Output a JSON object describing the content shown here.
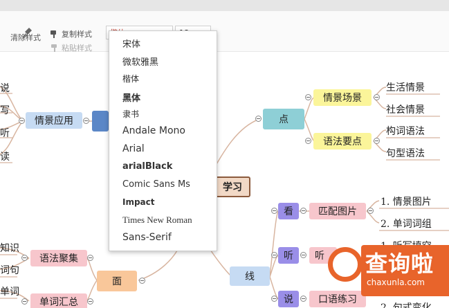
{
  "toolbar": {
    "clear_style": "清除样式",
    "copy_style": "复制样式",
    "paste_style": "粘贴样式",
    "font_value": "楷体",
    "size_value": "18"
  },
  "font_menu": {
    "items": [
      "宋体",
      "微软雅黑",
      "楷体",
      "黑体",
      "隶书",
      "Andale Mono",
      "Arial",
      "arialBlack",
      "Comic Sans Ms",
      "Impact",
      "Times New Roman",
      "Sans-Serif"
    ]
  },
  "mindmap": {
    "root": "学习",
    "left_partial": [
      "说",
      "写",
      "听",
      "读"
    ],
    "qingjing_yingyong": "情景应用",
    "dian": "点",
    "qingjing_changjing": "情景场景",
    "yufa_yaodian": "语法要点",
    "shenghuo_qingjing": "生活情景",
    "shehui_qingjing": "社会情景",
    "gouci_yufa": "构词语法",
    "juxing_yufa": "句型语法",
    "kan": "看",
    "pipei_tupian": "匹配图片",
    "tupian_1": "1. 情景图片",
    "danci_2": "2. 单词词组",
    "ting": "听",
    "ting_child": "听",
    "tingxie_1": "1. 听写填空",
    "shuo": "说",
    "kouyu_lianxi": "口语练习",
    "juzi_2": "2. 句式变化",
    "xian": "线",
    "mian": "面",
    "yufa_jujiao": "语法聚集",
    "danci_huizong": "单词汇总",
    "left_bottom_partial": [
      "知识",
      "词句",
      "单词"
    ]
  },
  "watermark": {
    "brand": "查询啦",
    "url": "chaxunla.com"
  },
  "colors": {
    "pink_node": "#f7c6cc",
    "yellow_node": "#fbf59a",
    "blue_node": "#c6dbf3",
    "teal_node": "#8ecfd6",
    "purple_node": "#9a8ee8",
    "orange_node": "#f9c79a",
    "root_fill": "#f2d9c6",
    "root_border": "#8b5a3c",
    "branch_line": "#d8b5a0",
    "watermark": "#e8642b"
  }
}
